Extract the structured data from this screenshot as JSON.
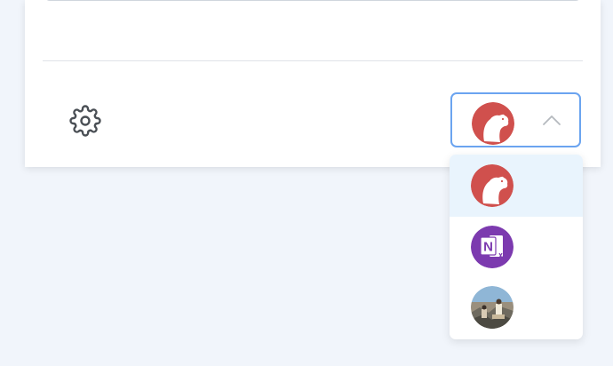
{
  "settings": {
    "icon": "gear-icon"
  },
  "account_switcher": {
    "selected": {
      "name": "",
      "icon": "bear-logo-icon",
      "color": "#d0504d"
    },
    "chevron_icon": "chevron-up-icon",
    "options": [
      {
        "icon": "bear-logo-icon",
        "color": "#d0504d",
        "selected": true
      },
      {
        "icon": "onenote-logo-icon",
        "letter": "N",
        "color": "#7c3aaf",
        "selected": false
      },
      {
        "icon": "photo-avatar-icon",
        "color": "#6b9ab8",
        "selected": false
      }
    ]
  },
  "colors": {
    "accent": "#6ba4f0",
    "selected_row": "#e9f4fd",
    "background": "#f1f5fb"
  }
}
